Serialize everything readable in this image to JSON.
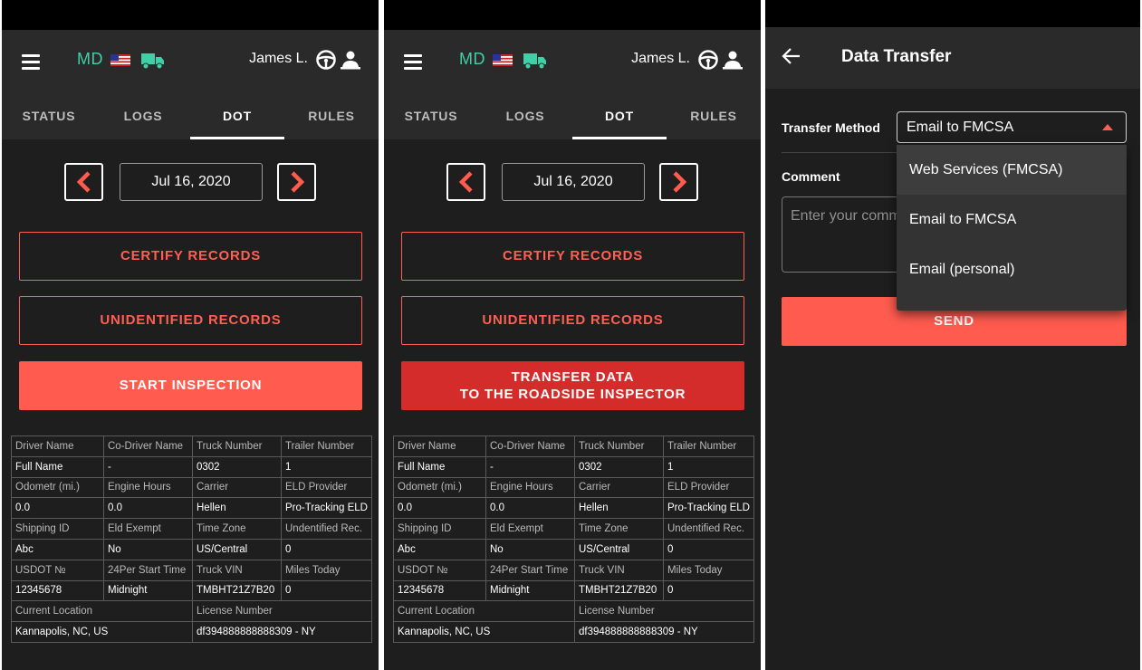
{
  "app": {
    "state_code": "MD",
    "driver_name": "James L.",
    "icons": {
      "menu": "hamburger-icon",
      "flag": "us-flag-icon",
      "truck": "truck-icon",
      "driver": "steering-wheel-icon",
      "codriver": "codriver-icon"
    },
    "colors": {
      "accent": "#ff5b4f",
      "accent_dark": "#d42b2b",
      "state": "#3fd0a8",
      "truck": "#3fd0a8",
      "background": "#1e1e1e",
      "bar": "#2a2a2a"
    }
  },
  "tabs": [
    {
      "label": "STATUS"
    },
    {
      "label": "LOGS"
    },
    {
      "label": "DOT"
    },
    {
      "label": "RULES"
    }
  ],
  "active_tab": "DOT",
  "date": {
    "label": "Jul 16, 2020"
  },
  "buttons": {
    "certify": "CERTIFY RECORDS",
    "unidentified": "UNIDENTIFIED RECORDS",
    "start_inspection": "START INSPECTION",
    "transfer_line1": "TRANSFER DATA",
    "transfer_line2": "TO THE ROADSIDE INSPECTOR"
  },
  "info_table": {
    "rows": [
      {
        "type": "hdr",
        "cells": [
          "Driver Name",
          "Co-Driver Name",
          "Truck Number",
          "Trailer Number"
        ]
      },
      {
        "type": "val",
        "cells": [
          "Full Name",
          "-",
          "0302",
          "1"
        ]
      },
      {
        "type": "hdr",
        "cells": [
          "Odometr (mi.)",
          "Engine Hours",
          "Carrier",
          "ELD Provider"
        ]
      },
      {
        "type": "val",
        "cells": [
          "0.0",
          "0.0",
          "Hellen",
          "Pro-Tracking ELD"
        ]
      },
      {
        "type": "hdr",
        "cells": [
          "Shipping ID",
          "Eld Exempt",
          "Time Zone",
          "Undentified Rec."
        ]
      },
      {
        "type": "val",
        "cells": [
          "Abc",
          "No",
          "US/Central",
          "0"
        ]
      },
      {
        "type": "hdr",
        "cells": [
          "USDOT №",
          "24Per Start Time",
          "Truck VIN",
          "Miles Today"
        ]
      },
      {
        "type": "val",
        "cells": [
          "12345678",
          "Midnight",
          "TMBHT21Z7B20",
          "0"
        ]
      },
      {
        "type": "hdr2",
        "cells": [
          "Current Location",
          "License Number"
        ]
      },
      {
        "type": "val2",
        "cells": [
          "Kannapolis, NC, US",
          "df394888888888309 - NY"
        ]
      }
    ]
  },
  "transfer": {
    "title": "Data Transfer",
    "method_label": "Transfer Method",
    "selected_method": "Email to FMCSA",
    "comment_label": "Comment",
    "comment_placeholder": "Enter your comment",
    "send_label": "SEND",
    "options": [
      "Web Services (FMCSA)",
      "Email to FMCSA",
      "Email (personal)"
    ],
    "highlighted_option": "Web Services (FMCSA)"
  }
}
